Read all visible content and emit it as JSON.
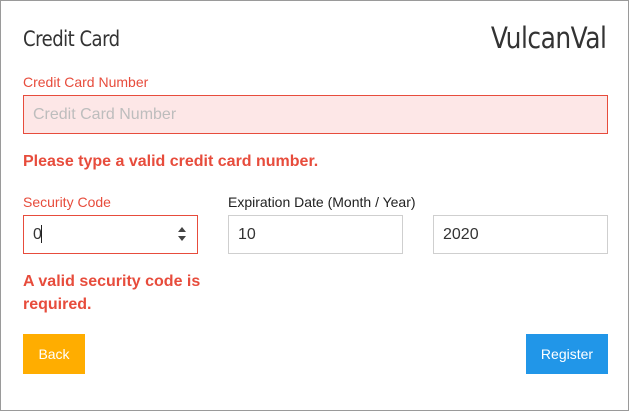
{
  "form": {
    "title": "Credit Card",
    "brand": "VulcanVal"
  },
  "card_number": {
    "label": "Credit Card Number",
    "placeholder": "Credit Card Number",
    "value": "",
    "error": "Please type a valid credit card number."
  },
  "security_code": {
    "label": "Security Code",
    "value": "0",
    "error": "A valid security code is required."
  },
  "expiration": {
    "label": "Expiration Date (Month / Year)",
    "month": "10",
    "year": "2020"
  },
  "buttons": {
    "back": "Back",
    "register": "Register"
  },
  "colors": {
    "error": "#e74c3c",
    "error_fill": "#fde7e7",
    "back_button": "#ffad00",
    "register_button": "#2196e8",
    "text": "#333333"
  }
}
